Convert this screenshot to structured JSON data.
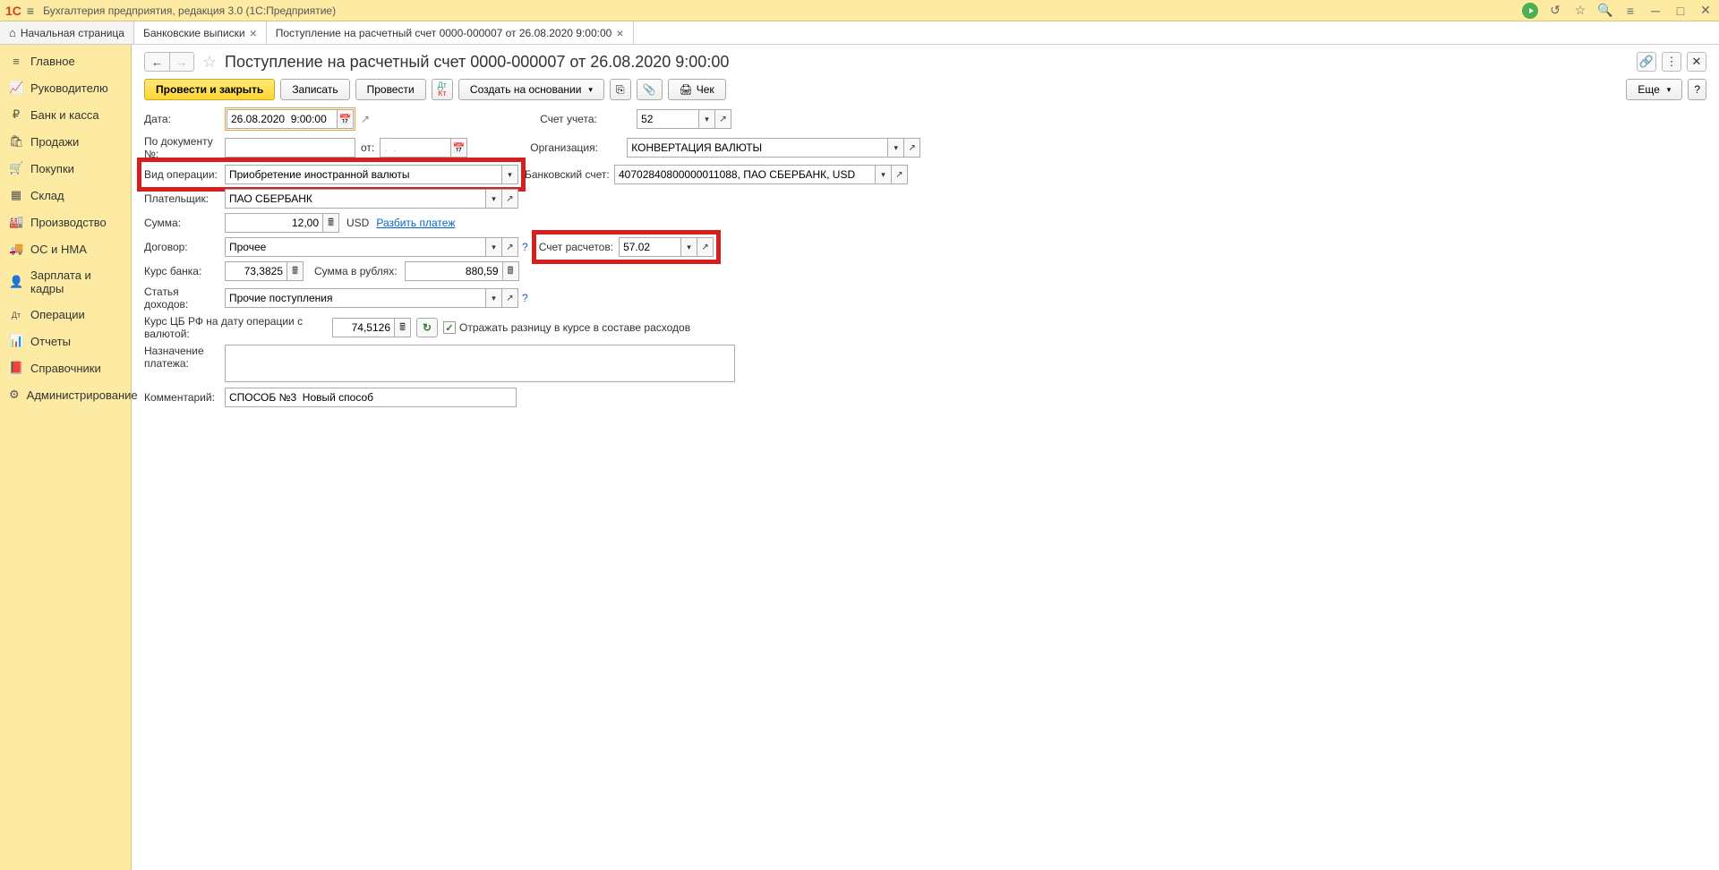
{
  "app": {
    "title": "Бухгалтерия предприятия, редакция 3.0  (1С:Предприятие)"
  },
  "tabs": {
    "home": "Начальная страница",
    "t1": "Банковские выписки",
    "t2": "Поступление на расчетный счет 0000-000007 от 26.08.2020 9:00:00"
  },
  "sidebar": {
    "items": [
      {
        "label": "Главное",
        "icon": "≡"
      },
      {
        "label": "Руководителю",
        "icon": "📈"
      },
      {
        "label": "Банк и касса",
        "icon": "₽"
      },
      {
        "label": "Продажи",
        "icon": "🛍"
      },
      {
        "label": "Покупки",
        "icon": "🛒"
      },
      {
        "label": "Склад",
        "icon": "▦"
      },
      {
        "label": "Производство",
        "icon": "🏭"
      },
      {
        "label": "ОС и НМА",
        "icon": "🚚"
      },
      {
        "label": "Зарплата и кадры",
        "icon": "👤"
      },
      {
        "label": "Операции",
        "icon": "Дт"
      },
      {
        "label": "Отчеты",
        "icon": "📊"
      },
      {
        "label": "Справочники",
        "icon": "📕"
      },
      {
        "label": "Администрирование",
        "icon": "⚙"
      }
    ]
  },
  "doc": {
    "title": "Поступление на расчетный счет 0000-000007 от 26.08.2020 9:00:00"
  },
  "toolbar": {
    "post_close": "Провести и закрыть",
    "save": "Записать",
    "post": "Провести",
    "create_based": "Создать на основании",
    "check": "Чек",
    "more": "Еще"
  },
  "labels": {
    "date": "Дата:",
    "docnum": "По документу №:",
    "from": "от:",
    "optype": "Вид операции:",
    "payer": "Плательщик:",
    "amount": "Сумма:",
    "contract": "Договор:",
    "bank_rate": "Курс банка:",
    "amount_rub": "Сумма в рублях:",
    "income_item": "Статья доходов:",
    "cb_rate": "Курс ЦБ РФ на дату операции с валютой:",
    "reflect": "Отражать разницу в курсе в составе расходов",
    "purpose": "Назначение платежа:",
    "comment": "Комментарий:",
    "account": "Счет учета:",
    "org": "Организация:",
    "bank_acc": "Банковский счет:",
    "settl_acc": "Счет расчетов:",
    "currency": "USD",
    "split": "Разбить платеж"
  },
  "values": {
    "date": "26.08.2020  9:00:00",
    "docnum": "",
    "from": ".  .",
    "optype": "Приобретение иностранной валюты",
    "payer": "ПАО СБЕРБАНК",
    "amount": "12,00",
    "contract": "Прочее",
    "bank_rate": "73,3825",
    "amount_rub": "880,59",
    "income_item": "Прочие поступления",
    "cb_rate": "74,5126",
    "purpose": "",
    "comment": "СПОСОБ №3  Новый способ",
    "account": "52",
    "org": "КОНВЕРТАЦИЯ ВАЛЮТЫ",
    "bank_acc": "40702840800000011088, ПАО СБЕРБАНК, USD",
    "settl_acc": "57.02"
  }
}
